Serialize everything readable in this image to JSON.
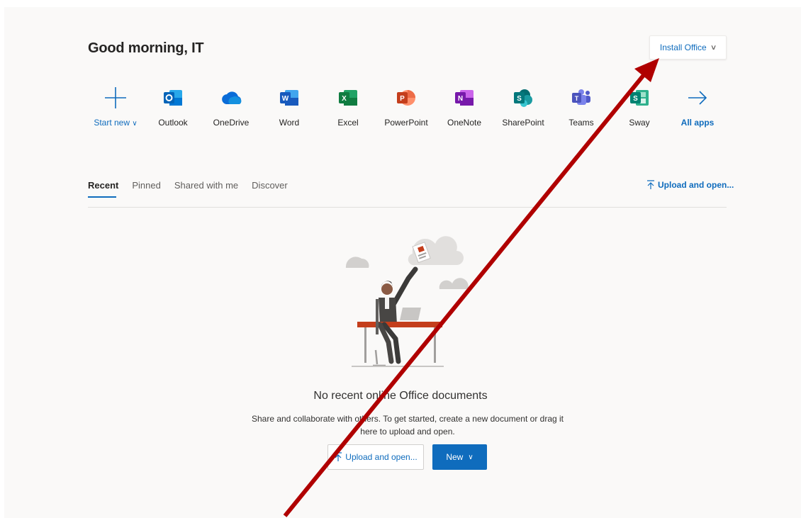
{
  "greeting": "Good morning, IT",
  "install_button": {
    "label": "Install Office",
    "chevron": "chevron-down-icon"
  },
  "apps": [
    {
      "label": "Start new",
      "icon": "plus-icon",
      "has_dropdown": true
    },
    {
      "label": "Outlook",
      "icon": "outlook-icon"
    },
    {
      "label": "OneDrive",
      "icon": "onedrive-icon"
    },
    {
      "label": "Word",
      "icon": "word-icon"
    },
    {
      "label": "Excel",
      "icon": "excel-icon"
    },
    {
      "label": "PowerPoint",
      "icon": "powerpoint-icon"
    },
    {
      "label": "OneNote",
      "icon": "onenote-icon"
    },
    {
      "label": "SharePoint",
      "icon": "sharepoint-icon"
    },
    {
      "label": "Teams",
      "icon": "teams-icon"
    },
    {
      "label": "Sway",
      "icon": "sway-icon"
    },
    {
      "label": "All apps",
      "icon": "arrow-right-icon"
    }
  ],
  "tabs": [
    {
      "label": "Recent",
      "active": true
    },
    {
      "label": "Pinned"
    },
    {
      "label": "Shared with me"
    },
    {
      "label": "Discover"
    }
  ],
  "upload_link": "Upload and open...",
  "empty_state": {
    "title": "No recent online Office documents",
    "description": "Share and collaborate with others. To get started, create a new document or drag it here to upload and open.",
    "upload_button": "Upload and open...",
    "new_button": "New"
  },
  "colors": {
    "accent": "#0f6cbd",
    "page_background": "#faf9f8",
    "annotation_arrow": "#b00000"
  }
}
